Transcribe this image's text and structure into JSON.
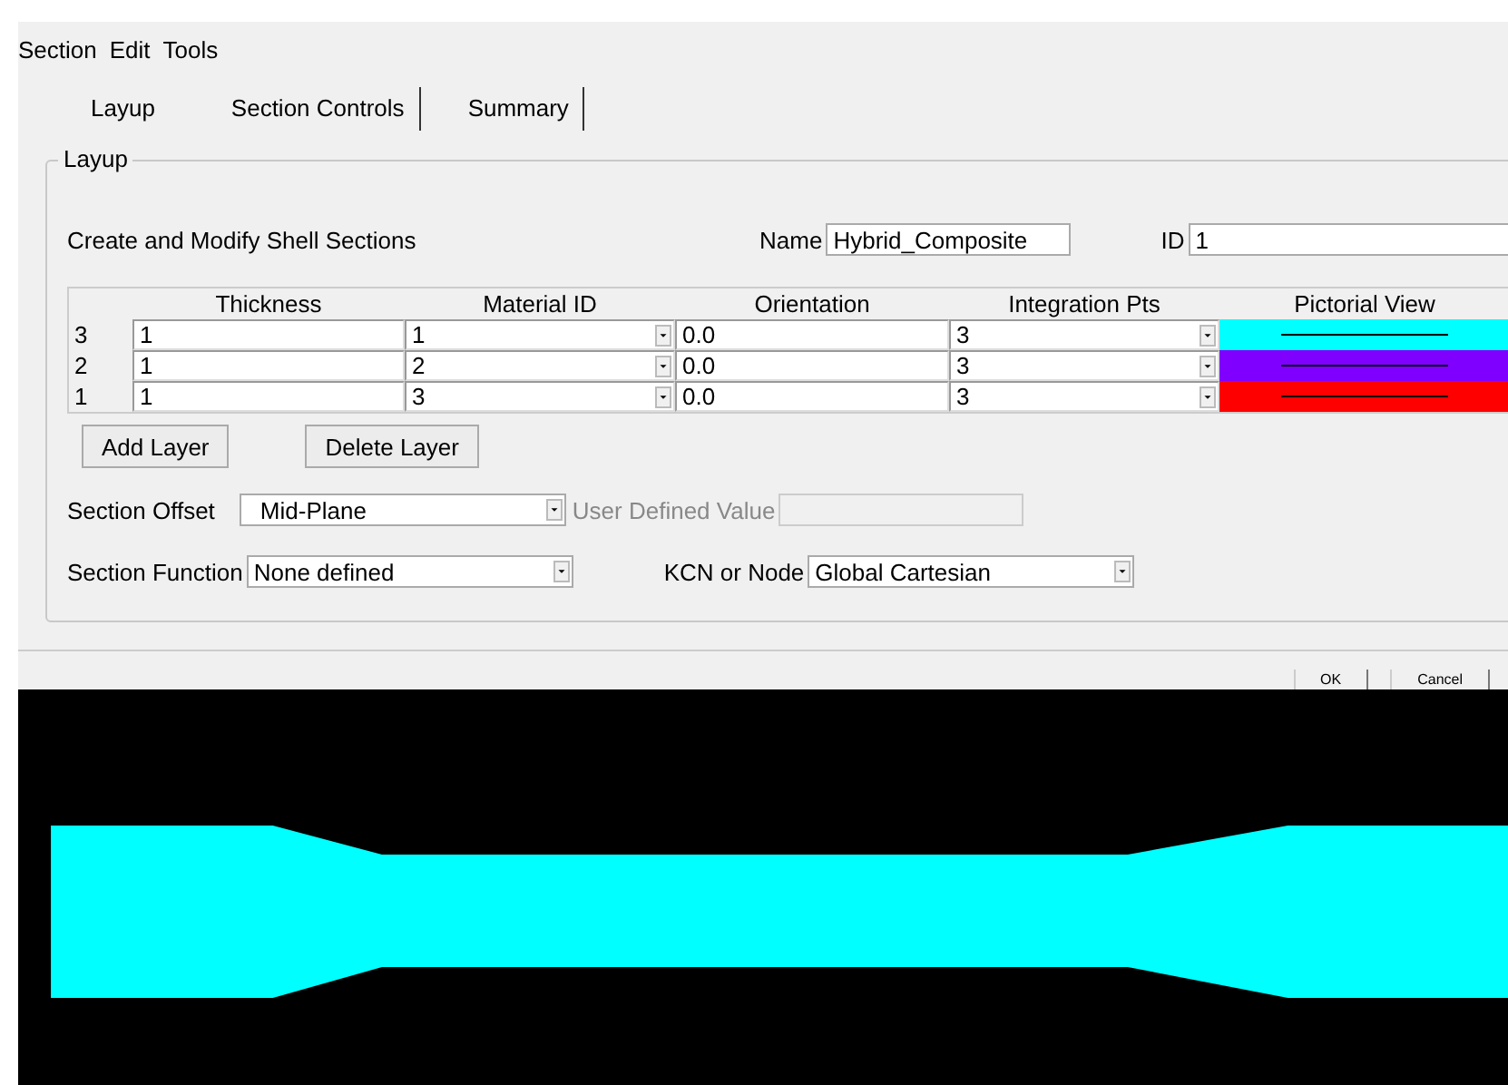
{
  "menu": [
    "Section",
    "Edit",
    "Tools"
  ],
  "tabs": [
    {
      "label": "Layup",
      "selected": true
    },
    {
      "label": "Section Controls",
      "selected": false
    },
    {
      "label": "Summary",
      "selected": false
    }
  ],
  "group": {
    "title": "Layup",
    "heading": "Create and Modify Shell Sections",
    "name_label": "Name",
    "name_value": "Hybrid_Composite",
    "id_label": "ID",
    "id_value": "1"
  },
  "table": {
    "columns": [
      "Thickness",
      "Material ID",
      "Orientation",
      "Integration Pts",
      "Pictorial View"
    ],
    "rows": [
      {
        "layer": "3",
        "thickness": "1",
        "material": "1",
        "orientation": "0.0",
        "points": "3",
        "color": "#00ffff"
      },
      {
        "layer": "2",
        "thickness": "1",
        "material": "2",
        "orientation": "0.0",
        "points": "3",
        "color": "#8000ff"
      },
      {
        "layer": "1",
        "thickness": "1",
        "material": "3",
        "orientation": "0.0",
        "points": "3",
        "color": "#ff0000"
      }
    ]
  },
  "layer_buttons": [
    "Add Layer",
    "Delete Layer"
  ],
  "section_offset": {
    "label": "Section Offset",
    "value": "Mid-Plane",
    "user_label": "User Defined Value",
    "user_disabled": true
  },
  "section_function": {
    "label": "Section Function",
    "value": "None defined",
    "kcn_label": "KCN or Node",
    "kcn_value": "Global Cartesian"
  },
  "dialog_buttons": [
    "OK",
    "Cancel"
  ]
}
